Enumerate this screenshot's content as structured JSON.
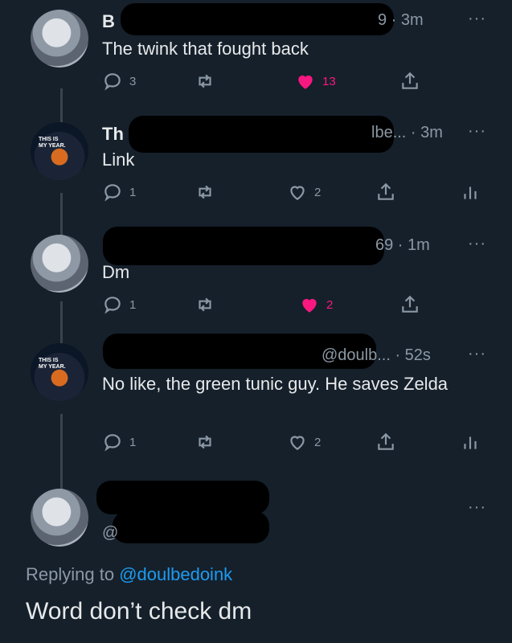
{
  "tweets": [
    {
      "name": "B",
      "meta": "9 · 3m",
      "text": "The twink that fought back",
      "replies": "3",
      "retweets": "",
      "likes": "13",
      "liked": true
    },
    {
      "name": "Th",
      "meta": "lbe... · 3m",
      "text": "Link",
      "replies": "1",
      "retweets": "",
      "likes": "2",
      "liked": false
    },
    {
      "name": "",
      "meta": "69 · 1m",
      "text": "Dm",
      "replies": "1",
      "retweets": "",
      "likes": "2",
      "liked": true
    },
    {
      "name": "",
      "meta": "@doulb... · 52s",
      "text": "No like, the green tunic guy. He saves Zelda",
      "replies": "1",
      "retweets": "",
      "likes": "2",
      "liked": false
    }
  ],
  "compose": {
    "replying_prefix": "Replying to ",
    "replying_handle": "@doulbedoink",
    "text": "Word don’t check dm",
    "avatar_handle_initial": "@"
  },
  "avatar_caption": {
    "line1": "THIS IS",
    "line2": "MY YEAR."
  },
  "more_icon": "···",
  "colors": {
    "background": "#15202b",
    "like": "#f91880",
    "link": "#1d9bf0"
  }
}
